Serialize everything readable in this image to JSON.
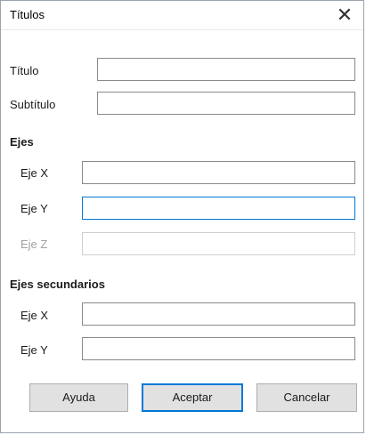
{
  "dialog": {
    "title": "Títulos",
    "close_glyph": "✕"
  },
  "fields": {
    "titulo_label": "Título",
    "subtitulo_label": "Subtítulo",
    "titulo_value": "",
    "subtitulo_value": ""
  },
  "ejes": {
    "heading": "Ejes",
    "x_label": "Eje X",
    "y_label": "Eje Y",
    "z_label": "Eje Z",
    "x_value": "",
    "y_value": "",
    "z_value": ""
  },
  "ejes_secundarios": {
    "heading": "Ejes secundarios",
    "x_label": "Eje X",
    "y_label": "Eje Y",
    "x_value": "",
    "y_value": ""
  },
  "buttons": {
    "help": "Ayuda",
    "ok": "Aceptar",
    "cancel": "Cancelar"
  },
  "colors": {
    "focus_accent": "#0078d7",
    "button_face": "#e1e1e1"
  }
}
